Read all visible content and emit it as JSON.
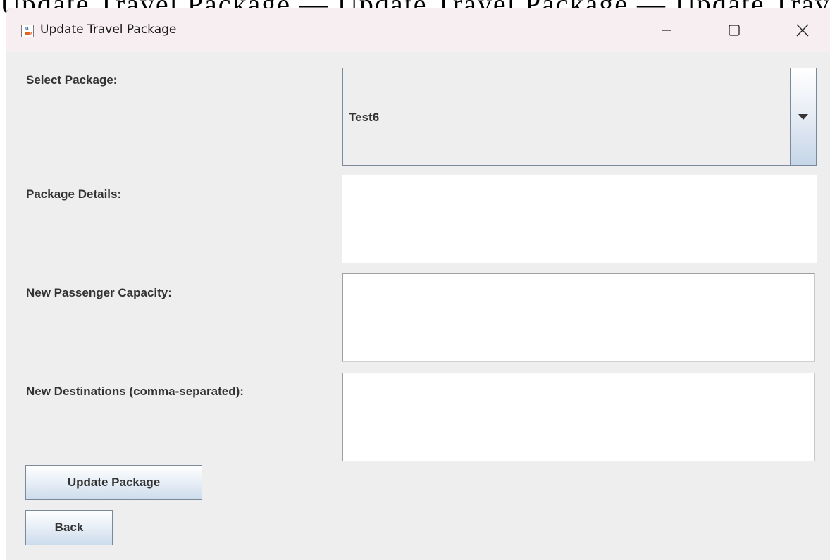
{
  "backdrop": {
    "text": "Update Travel Package — Update Travel Package — Update Travel Package"
  },
  "window": {
    "title": "Update Travel Package",
    "app_icon": "java-cup-icon",
    "controls": {
      "minimize_icon": "minimize-icon",
      "maximize_icon": "maximize-icon",
      "close_icon": "close-icon"
    }
  },
  "form": {
    "select_package_label": "Select Package:",
    "selected_package": "Test6",
    "package_details_label": "Package Details:",
    "package_details_value": "",
    "capacity_label": "New Passenger Capacity:",
    "capacity_value": "",
    "destinations_label": "New Destinations (comma-separated):",
    "destinations_value": ""
  },
  "buttons": {
    "update_label": "Update Package",
    "back_label": "Back"
  },
  "colors": {
    "window_bg": "#eeeeee",
    "titlebar_bg": "#f7eef1",
    "label_text": "#333333",
    "field_bg": "#ffffff",
    "button_border": "#7a8a9a"
  }
}
